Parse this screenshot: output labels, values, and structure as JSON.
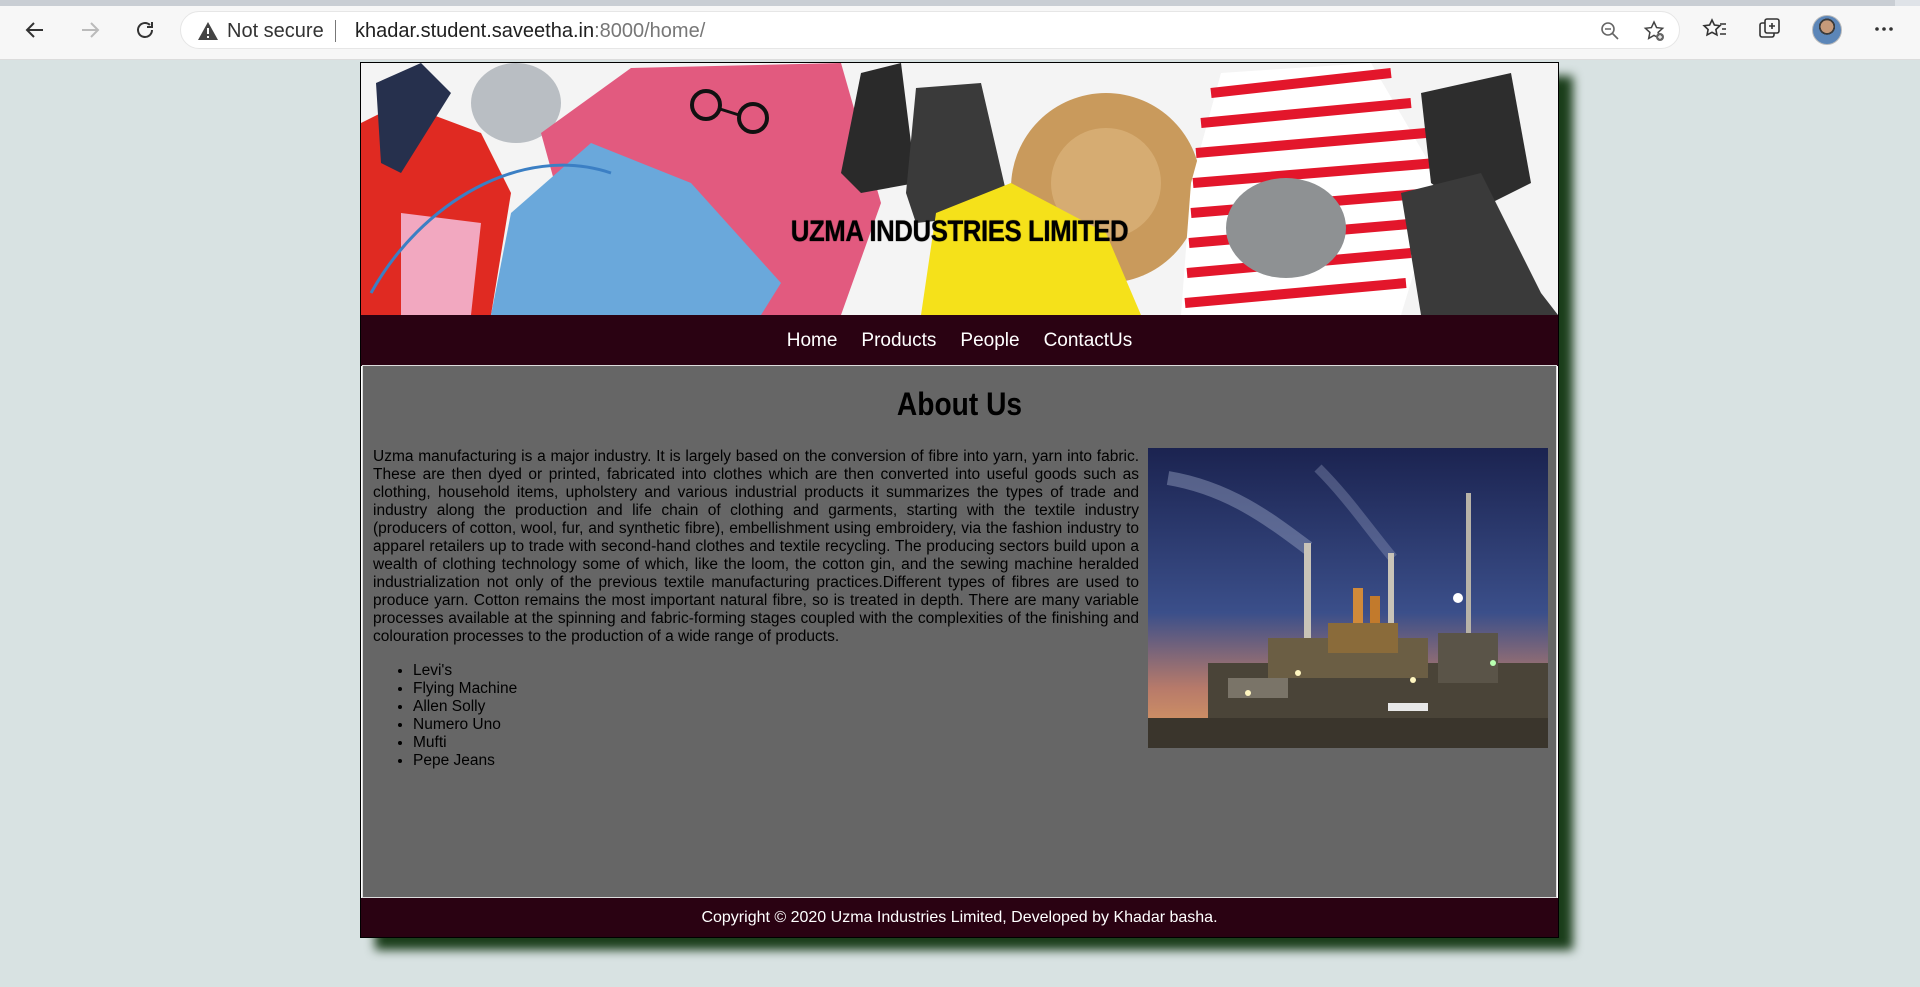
{
  "browser": {
    "not_secure_label": "Not secure",
    "url_host": "khadar.student.saveetha.in",
    "url_path": ":8000/home/"
  },
  "site": {
    "title": "UZMA INDUSTRIES LIMITED",
    "nav": [
      "Home",
      "Products",
      "People",
      "ContactUs"
    ],
    "about_heading": "About Us",
    "about_text": "Uzma manufacturing is a major industry. It is largely based on the conversion of fibre into yarn, yarn into fabric. These are then dyed or printed, fabricated into clothes which are then converted into useful goods such as clothing, household items, upholstery and various industrial products it summarizes the types of trade and industry along the production and life chain of clothing and garments, starting with the textile industry (producers of cotton, wool, fur, and synthetic fibre), embellishment using embroidery, via the fashion industry to apparel retailers up to trade with second-hand clothes and textile recycling. The producing sectors build upon a wealth of clothing technology some of which, like the loom, the cotton gin, and the sewing machine heralded industrialization not only of the previous textile manufacturing practices.Different types of fibres are used to produce yarn. Cotton remains the most important natural fibre, so is treated in depth. There are many variable processes available at the spinning and fabric-forming stages coupled with the complexities of the finishing and colouration processes to the production of a wide range of products.",
    "brands": [
      "Levi's",
      "Flying Machine",
      "Allen Solly",
      "Numero Uno",
      "Mufti",
      "Pepe Jeans"
    ],
    "footer": "Copyright © 2020 Uzma Industries Limited, Developed by Khadar basha."
  }
}
